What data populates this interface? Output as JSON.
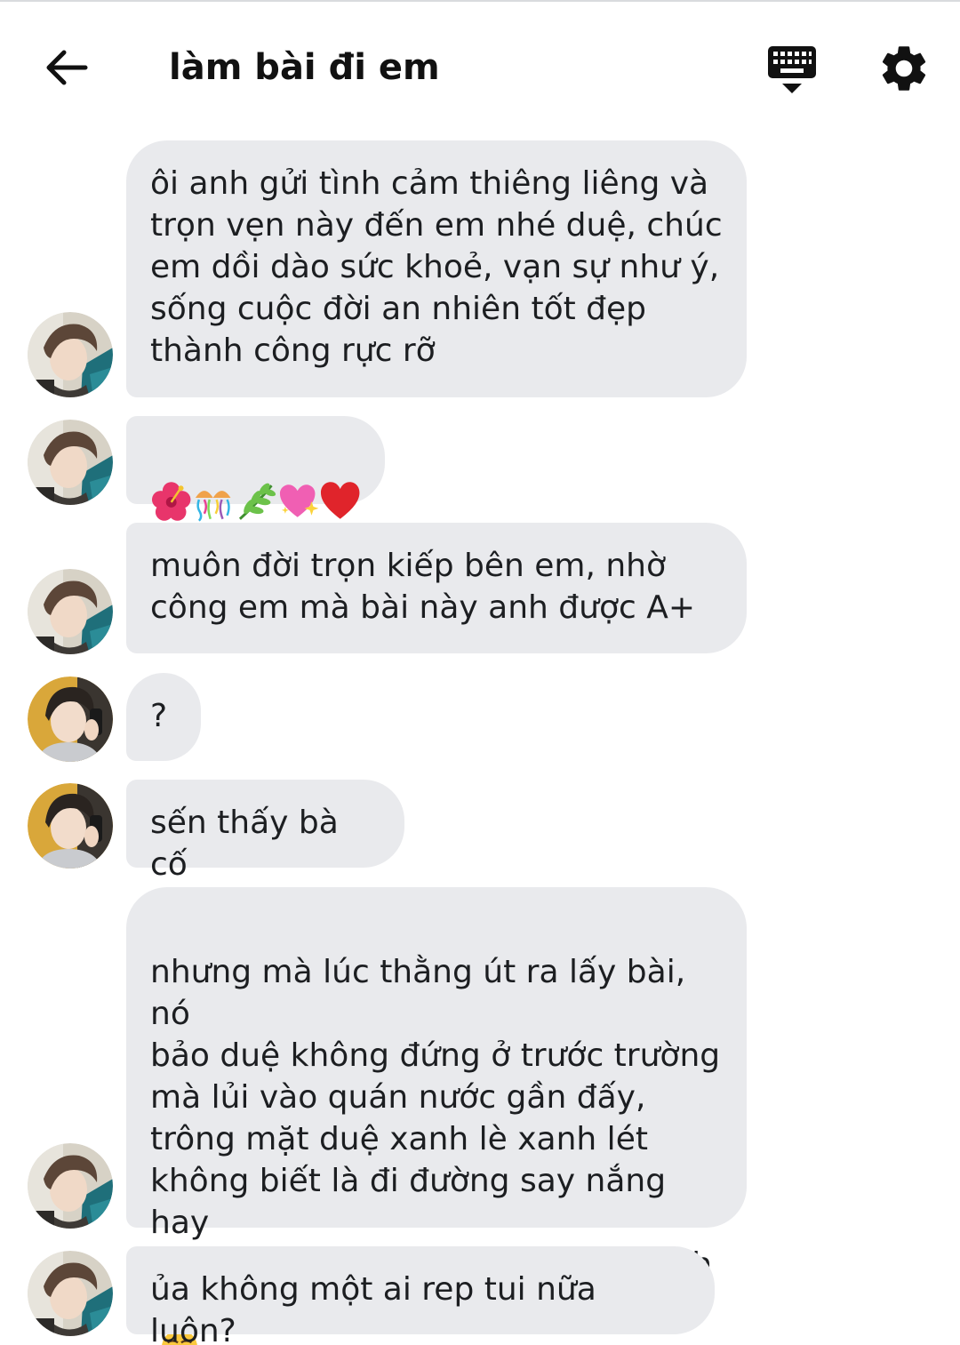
{
  "header": {
    "title": "làm bài đi em",
    "back_icon": "arrow-back-icon",
    "keyboard_icon": "keyboard-hide-icon",
    "settings_icon": "gear-icon"
  },
  "colors": {
    "bubble": "#e9eaed",
    "text": "#1c1e21",
    "background": "#ffffff"
  },
  "messages": [
    {
      "sender": "a",
      "text": "ôi anh gửi tình cảm thiêng liêng và\ntrọn vẹn này đến em nhé duệ, chúc\nem dồi dào sức khoẻ, vạn sự như ý,\nsống cuộc đời an nhiên tốt đẹp\nthành công rực rỡ"
    },
    {
      "sender": "a",
      "emojis": [
        "hibiscus-emoji",
        "jellyfish-confetti-emoji",
        "herb-emoji",
        "sparkling-heart-emoji",
        "red-heart-emoji"
      ]
    },
    {
      "sender": "a",
      "text": "muôn đời trọn kiếp bên em, nhờ\ncông em mà bài này anh được A+"
    },
    {
      "sender": "b",
      "text": "?"
    },
    {
      "sender": "b",
      "text": "sến thấy bà cố"
    },
    {
      "sender": "a",
      "text": "nhưng mà lúc thằng út ra lấy bài, nó\nbảo duệ không đứng ở trước trường\nmà lủi vào quán nước gần đấy,\ntrông mặt duệ xanh lè xanh lét\nkhông biết là đi đường say nắng hay\nsao? hic anh xin lỗi nhé lỗi của anh\nbáo hại mày không",
      "trailing_emoji": "loudly-crying-face-emoji"
    },
    {
      "sender": "a",
      "text": "ủa không một ai rep tui nữa luôn?"
    }
  ]
}
